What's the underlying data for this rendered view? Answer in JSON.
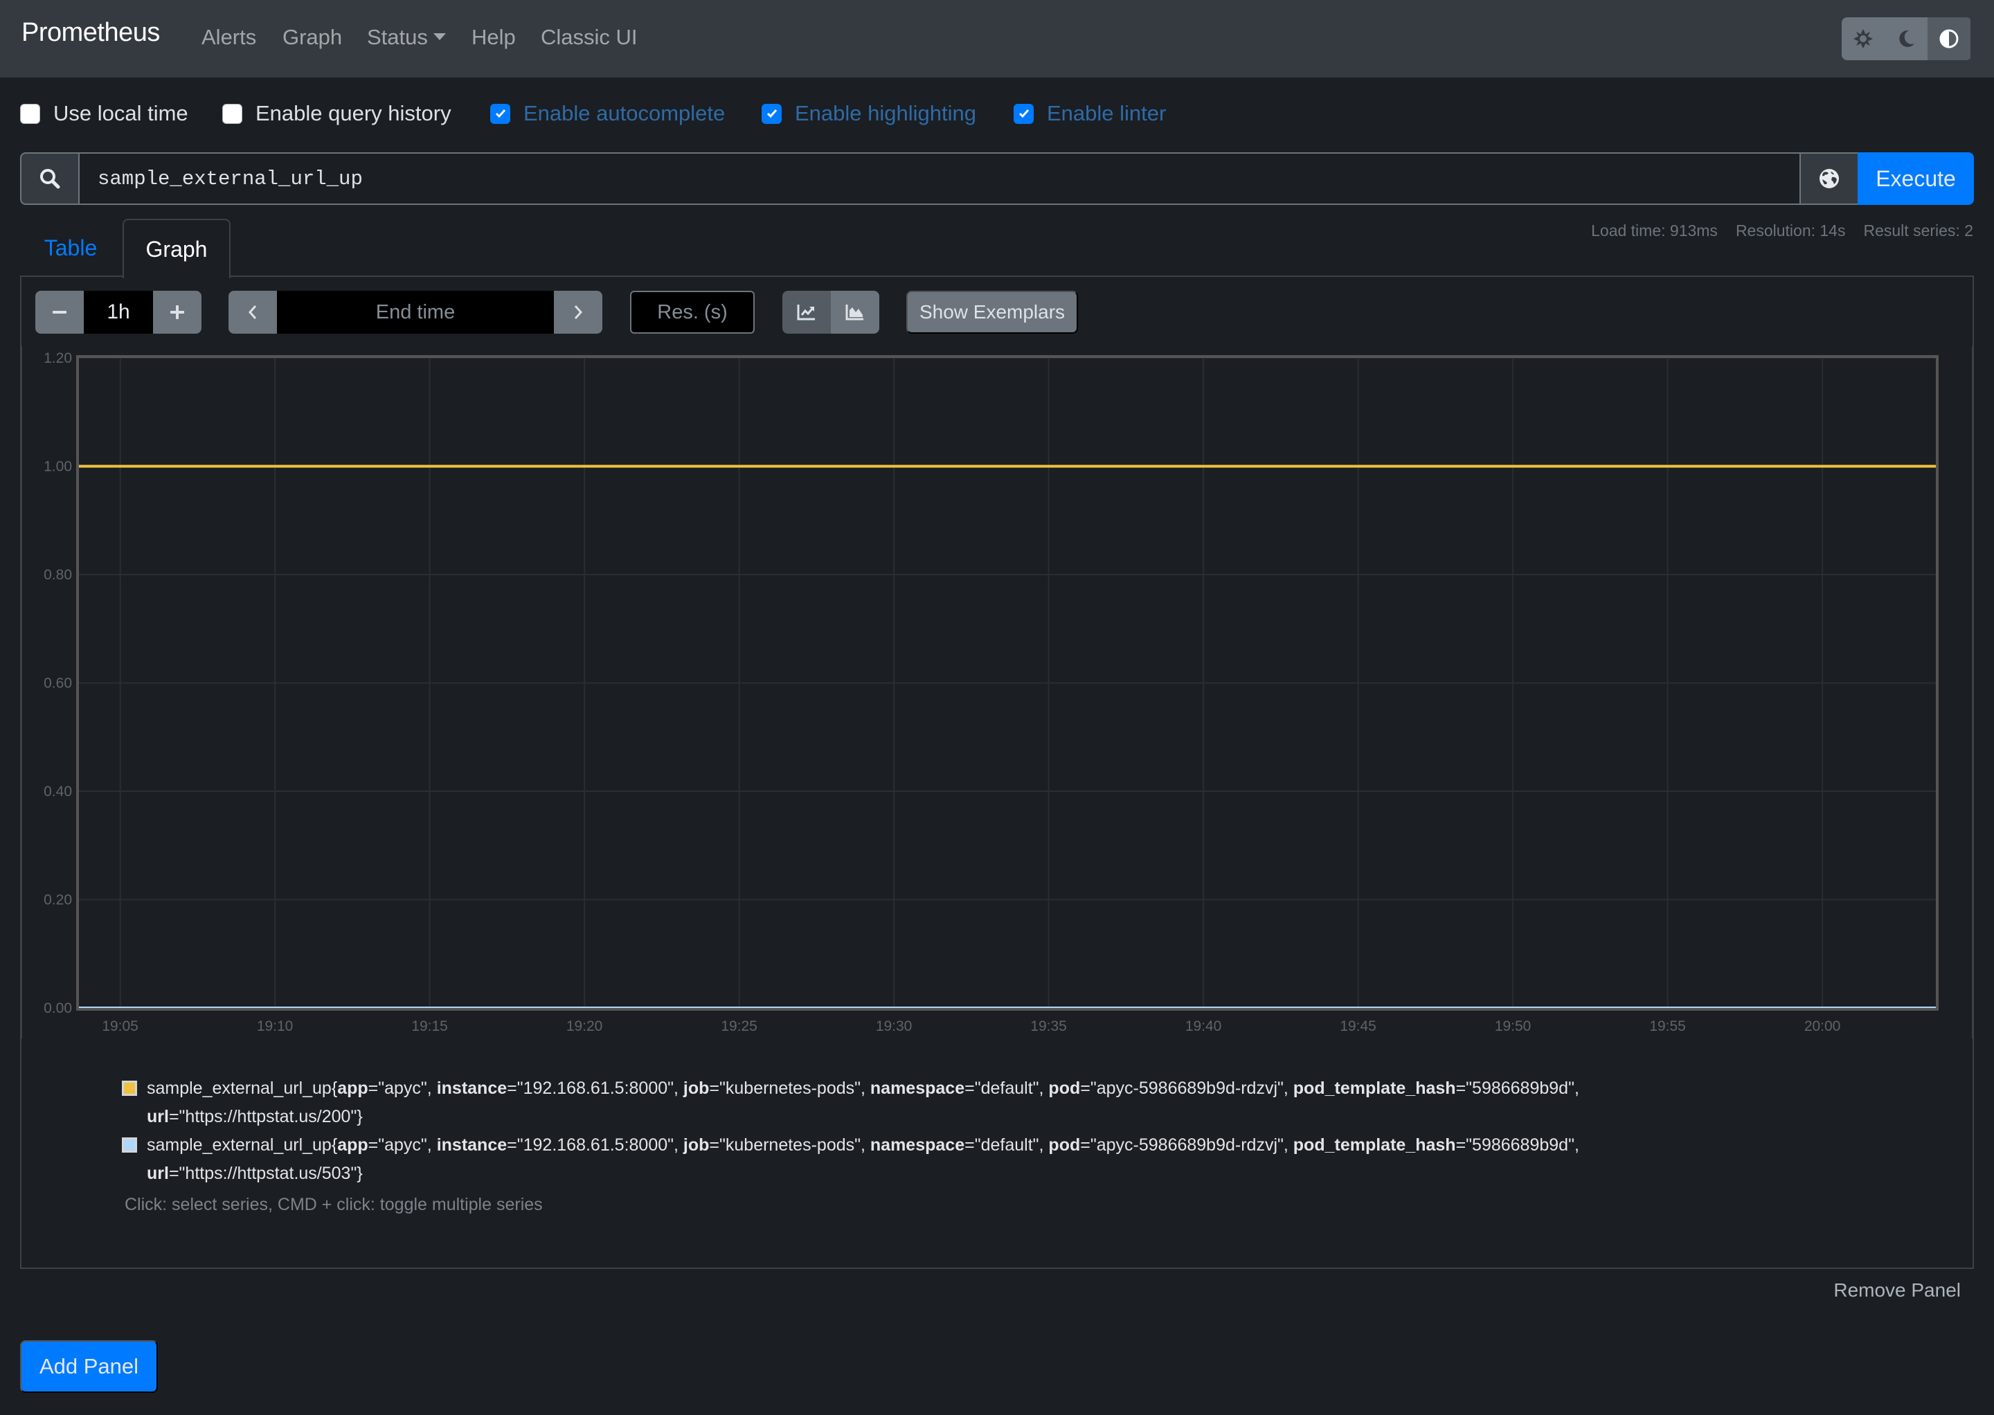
{
  "navbar": {
    "brand": "Prometheus",
    "items": [
      {
        "label": "Alerts"
      },
      {
        "label": "Graph"
      },
      {
        "label": "Status",
        "has_dropdown": true
      },
      {
        "label": "Help"
      },
      {
        "label": "Classic UI"
      }
    ],
    "theme_buttons": [
      {
        "icon": "sun-icon",
        "label": "light"
      },
      {
        "icon": "moon-icon",
        "label": "dark"
      },
      {
        "icon": "contrast-icon",
        "label": "browser-default",
        "active": true
      }
    ]
  },
  "options": [
    {
      "label": "Use local time",
      "checked": false
    },
    {
      "label": "Enable query history",
      "checked": false
    },
    {
      "label": "Enable autocomplete",
      "checked": true
    },
    {
      "label": "Enable highlighting",
      "checked": true
    },
    {
      "label": "Enable linter",
      "checked": true
    }
  ],
  "query": {
    "value": "sample_external_url_up",
    "execute_label": "Execute",
    "metrics_explorer_icon": "globe-icon"
  },
  "stats": {
    "load_time": "Load time: 913ms",
    "resolution": "Resolution: 14s",
    "result_series": "Result series: 2"
  },
  "tabs": [
    {
      "label": "Table",
      "active": false
    },
    {
      "label": "Graph",
      "active": true
    }
  ],
  "controls": {
    "range": "1h",
    "end_time_placeholder": "End time",
    "resolution_placeholder": "Res. (s)",
    "show_exemplars_label": "Show Exemplars",
    "stacked": false
  },
  "colors": {
    "accent": "#007bff",
    "series_1": "#edc240",
    "series_2": "#afd8f8"
  },
  "chart_data": {
    "type": "line",
    "title": "",
    "xlabel": "",
    "ylabel": "",
    "x_ticks": [
      "19:05",
      "19:10",
      "19:15",
      "19:20",
      "19:25",
      "19:30",
      "19:35",
      "19:40",
      "19:45",
      "19:50",
      "19:55",
      "20:00"
    ],
    "y_ticks": [
      "0.00",
      "0.20",
      "0.40",
      "0.60",
      "0.80",
      "1.00",
      "1.20"
    ],
    "ylim": [
      0,
      1.2
    ],
    "x_range_minutes": [
      0,
      60
    ],
    "x_start": "19:03:40",
    "x_end": "20:03:40",
    "grid": true,
    "series": [
      {
        "name": "sample_external_url_up{app=\"apyc\", instance=\"192.168.61.5:8000\", job=\"kubernetes-pods\", namespace=\"default\", pod=\"apyc-5986689b9d-rdzvj\", pod_template_hash=\"5986689b9d\", url=\"https://httpstat.us/200\"}",
        "color": "#edc240",
        "x": [
          0,
          60
        ],
        "values": [
          1,
          1
        ]
      },
      {
        "name": "sample_external_url_up{app=\"apyc\", instance=\"192.168.61.5:8000\", job=\"kubernetes-pods\", namespace=\"default\", pod=\"apyc-5986689b9d-rdzvj\", pod_template_hash=\"5986689b9d\", url=\"https://httpstat.us/503\"}",
        "color": "#afd8f8",
        "x": [
          0,
          60
        ],
        "values": [
          0,
          0
        ]
      }
    ]
  },
  "legend": {
    "items": [
      {
        "metric": "sample_external_url_up",
        "color": "#edc240",
        "labels": [
          {
            "key": "app",
            "value": "\"apyc\""
          },
          {
            "key": "instance",
            "value": "\"192.168.61.5:8000\""
          },
          {
            "key": "job",
            "value": "\"kubernetes-pods\""
          },
          {
            "key": "namespace",
            "value": "\"default\""
          },
          {
            "key": "pod",
            "value": "\"apyc-5986689b9d-rdzvj\""
          },
          {
            "key": "pod_template_hash",
            "value": "\"5986689b9d\""
          },
          {
            "key": "url",
            "value": "\"https://httpstat.us/200\""
          }
        ]
      },
      {
        "metric": "sample_external_url_up",
        "color": "#afd8f8",
        "labels": [
          {
            "key": "app",
            "value": "\"apyc\""
          },
          {
            "key": "instance",
            "value": "\"192.168.61.5:8000\""
          },
          {
            "key": "job",
            "value": "\"kubernetes-pods\""
          },
          {
            "key": "namespace",
            "value": "\"default\""
          },
          {
            "key": "pod",
            "value": "\"apyc-5986689b9d-rdzvj\""
          },
          {
            "key": "pod_template_hash",
            "value": "\"5986689b9d\""
          },
          {
            "key": "url",
            "value": "\"https://httpstat.us/503\""
          }
        ]
      }
    ],
    "hint": "Click: select series, CMD + click: toggle multiple series"
  },
  "panel": {
    "remove_label": "Remove Panel"
  },
  "add_panel_label": "Add Panel"
}
